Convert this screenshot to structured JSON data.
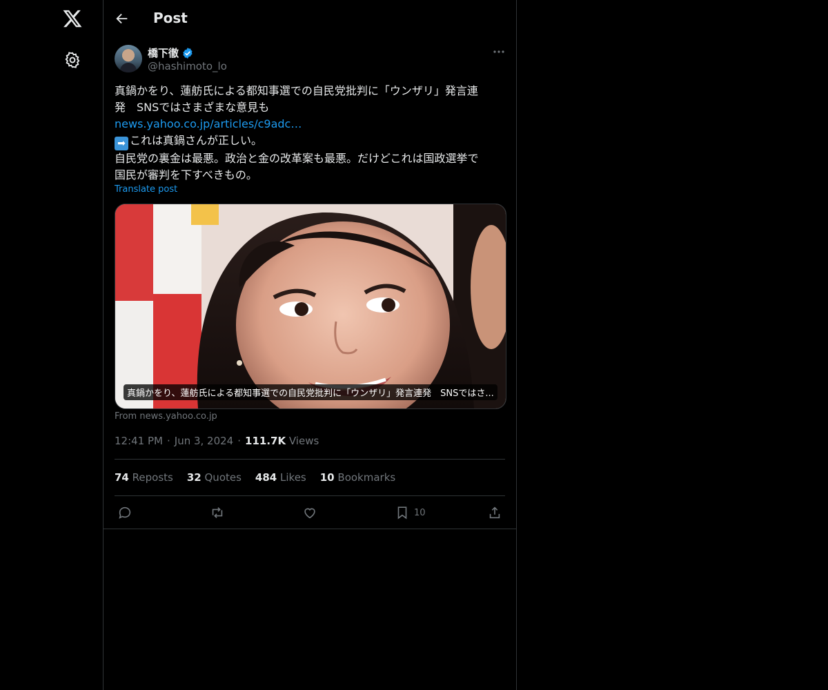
{
  "header": {
    "title": "Post"
  },
  "author": {
    "name": "橋下徹",
    "handle": "@hashimoto_lo"
  },
  "post": {
    "line1": "真鍋かをり、蓮舫氏による都知事選での自民党批判に「ウンザリ」発言連",
    "line2": "発　SNSではさまざまな意見も",
    "link": "news.yahoo.co.jp/articles/c9adc…",
    "arrow": "➡",
    "line3": "これは真鍋さんが正しい。",
    "line4": "自民党の裏金は最悪。政治と金の改革案も最悪。だけどこれは国政選挙で",
    "line5": "国民が審判を下すべきもの。",
    "translate": "Translate post"
  },
  "card": {
    "caption": "真鍋かをり、蓮舫氏による都知事選での自民党批判に「ウンザリ」発言連発　SNSではさ...",
    "from": "From news.yahoo.co.jp"
  },
  "meta": {
    "time": "12:41 PM",
    "sep": "·",
    "date": "Jun 3, 2024",
    "views_count": "111.7K",
    "views_label": "Views"
  },
  "stats": {
    "reposts_count": "74",
    "reposts_label": "Reposts",
    "quotes_count": "32",
    "quotes_label": "Quotes",
    "likes_count": "484",
    "likes_label": "Likes",
    "bookmarks_count": "10",
    "bookmarks_label": "Bookmarks"
  },
  "actions": {
    "bookmark_count": "10"
  },
  "colors": {
    "accent": "#1d9bf0",
    "background": "#000000",
    "border": "#2f3336",
    "muted": "#71767b"
  },
  "icons": [
    "x-logo-icon",
    "settings-gear-icon",
    "back-arrow-icon",
    "verified-badge-icon",
    "more-icon",
    "reply-icon",
    "repost-icon",
    "like-icon",
    "bookmark-icon",
    "share-icon"
  ]
}
